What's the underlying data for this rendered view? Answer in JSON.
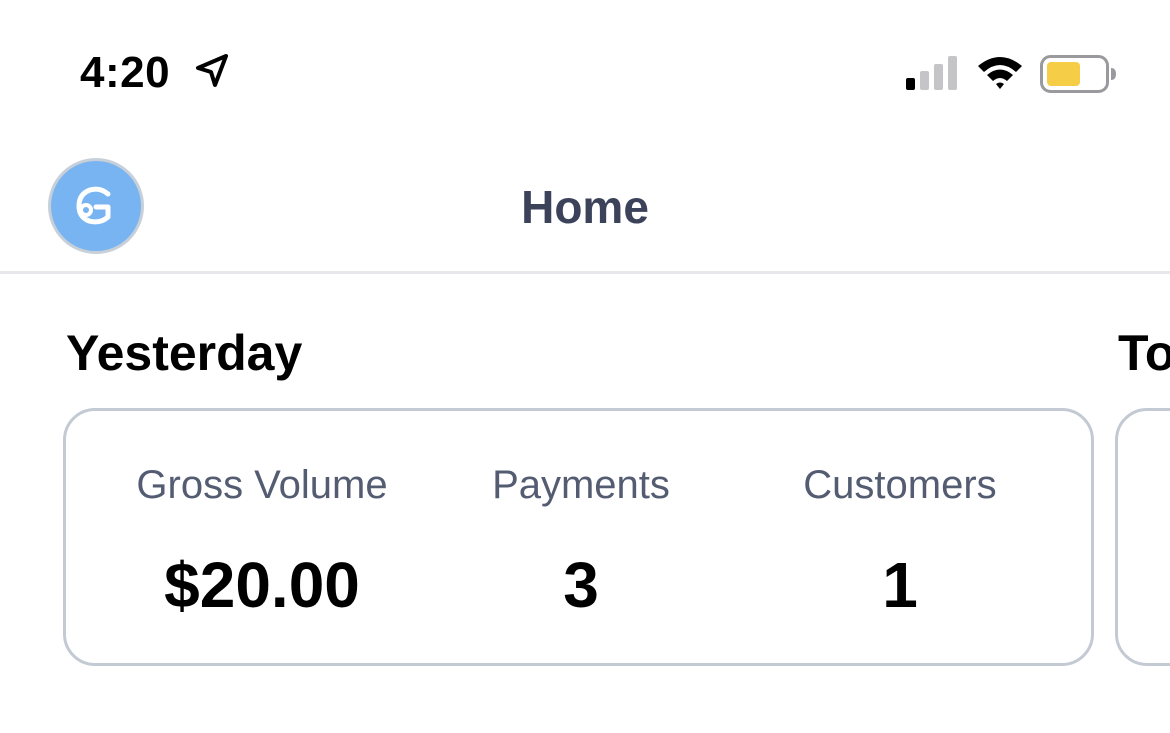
{
  "status_bar": {
    "time": "4:20",
    "icons": [
      "location-arrow-icon",
      "cellular-signal-icon",
      "wifi-icon",
      "battery-icon"
    ],
    "battery_color": "#f5cd47"
  },
  "nav": {
    "title": "Home",
    "avatar_icon": "app-logo-icon",
    "avatar_color": "#78b4f2"
  },
  "sections": {
    "yesterday": {
      "title": "Yesterday",
      "metrics": [
        {
          "label": "Gross Volume",
          "value": "$20.00"
        },
        {
          "label": "Payments",
          "value": "3"
        },
        {
          "label": "Customers",
          "value": "1"
        }
      ]
    },
    "today": {
      "title": "To"
    }
  }
}
